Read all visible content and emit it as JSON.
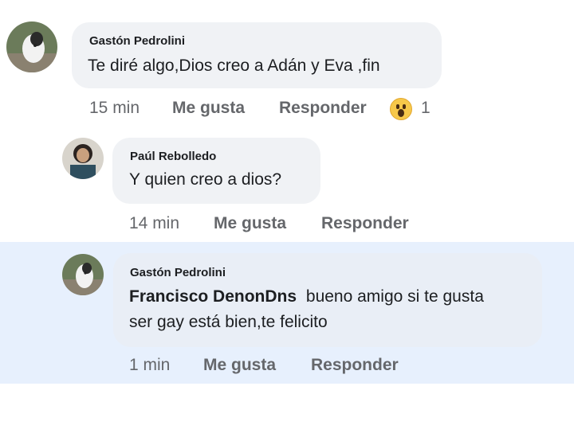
{
  "comments": [
    {
      "author": "Gastón Pedrolini",
      "text": "Te diré algo,Dios creo a Adán y Eva ,fin",
      "time": "15 min",
      "like": "Me gusta",
      "reply": "Responder",
      "reaction_icon": "astonished-emoji-icon",
      "reaction_count": "1"
    },
    {
      "author": "Paúl Rebolledo",
      "text": "Y quien creo a dios?",
      "time": "14 min",
      "like": "Me gusta",
      "reply": "Responder"
    },
    {
      "author": "Gastón Pedrolini",
      "mention": "Francisco DenonDns",
      "text_line1": "bueno amigo si te gusta",
      "text_line2": "ser gay está bien,te felicito",
      "time": "1 min",
      "like": "Me gusta",
      "reply": "Responder"
    }
  ],
  "colors": {
    "highlight_background": "#e7f0fd",
    "bubble_background": "#f0f2f5",
    "meta_text": "#65676b"
  }
}
